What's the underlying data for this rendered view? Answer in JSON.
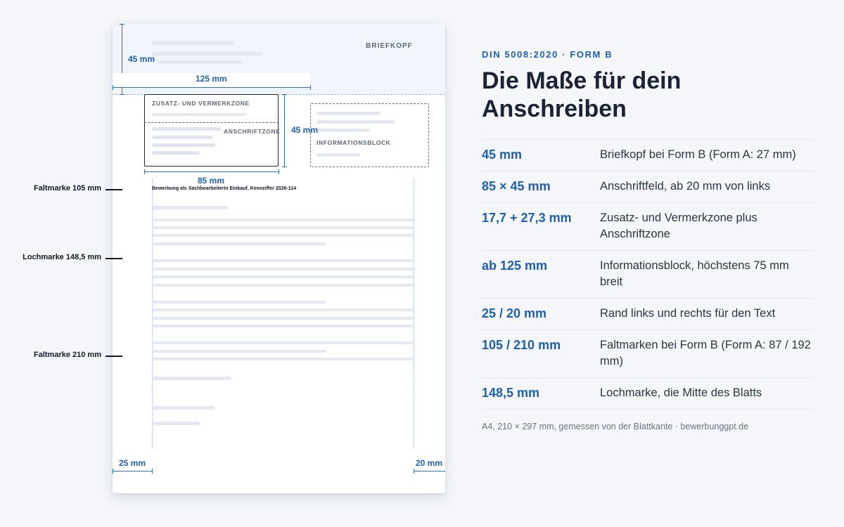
{
  "sheet": {
    "briefkopf_label": "BRIEFKOPF",
    "zusatz_label": "ZUSATZ- UND VERMERKZONE",
    "anschrift_label": "ANSCHRIFTZONE",
    "info_label": "INFORMATIONSBLOCK",
    "subject": "Bewerbung als Sachbearbeiterin Einkauf, Kennziffer 2026-114",
    "dims": {
      "briefkopf_height": "45 mm",
      "info_offset": "125 mm",
      "address_height": "45 mm",
      "address_width": "85 mm",
      "margin_left": "25 mm",
      "margin_right": "20 mm"
    },
    "markers": {
      "fold_105": "Faltmarke 105 mm",
      "punch": "Lochmarke 148,5 mm",
      "fold_210": "Faltmarke 210 mm"
    }
  },
  "panel": {
    "eyebrow": "DIN 5008:2020 · FORM B",
    "title": "Die Maße für dein Anschreiben",
    "specs": [
      {
        "value": "45 mm",
        "desc": "Briefkopf bei Form B (Form A: 27 mm)"
      },
      {
        "value": "85 × 45 mm",
        "desc": "Anschriftfeld, ab 20 mm von links"
      },
      {
        "value": "17,7 + 27,3 mm",
        "desc": "Zusatz- und Vermerkzone plus Anschriftzone"
      },
      {
        "value": "ab 125 mm",
        "desc": "Informationsblock, höchstens 75 mm breit"
      },
      {
        "value": "25 / 20 mm",
        "desc": "Rand links und rechts für den Text"
      },
      {
        "value": "105 / 210 mm",
        "desc": "Faltmarken bei Form B (Form A: 87 / 192 mm)"
      },
      {
        "value": "148,5 mm",
        "desc": "Lochmarke, die Mitte des Blatts"
      }
    ],
    "footnote": "A4, 210 × 297 mm, gemessen von der Blattkante · bewerbunggpt.de"
  },
  "colors": {
    "accent": "#1f5fb0",
    "text": "#1b2436",
    "letterhead_bg": "#f0f4fb",
    "placeholder_bar": "#e4e8f1"
  }
}
